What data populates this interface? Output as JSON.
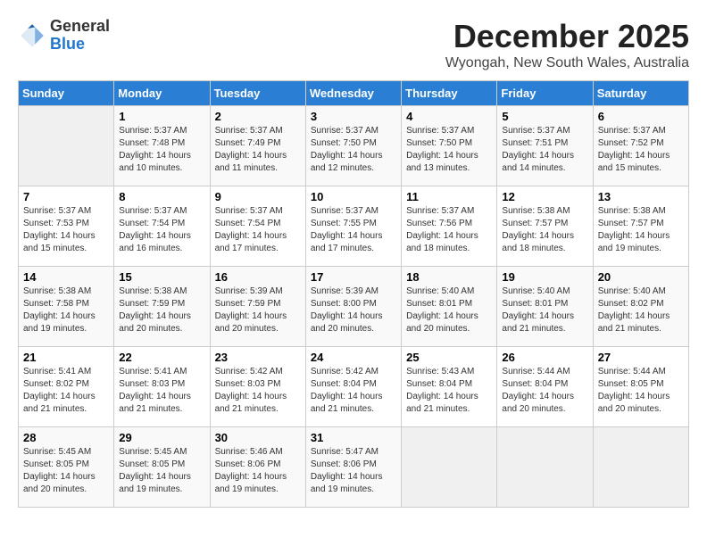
{
  "logo": {
    "general": "General",
    "blue": "Blue"
  },
  "title": "December 2025",
  "subtitle": "Wyongah, New South Wales, Australia",
  "weekdays": [
    "Sunday",
    "Monday",
    "Tuesday",
    "Wednesday",
    "Thursday",
    "Friday",
    "Saturday"
  ],
  "weeks": [
    [
      {
        "day": "",
        "info": ""
      },
      {
        "day": "1",
        "info": "Sunrise: 5:37 AM\nSunset: 7:48 PM\nDaylight: 14 hours\nand 10 minutes."
      },
      {
        "day": "2",
        "info": "Sunrise: 5:37 AM\nSunset: 7:49 PM\nDaylight: 14 hours\nand 11 minutes."
      },
      {
        "day": "3",
        "info": "Sunrise: 5:37 AM\nSunset: 7:50 PM\nDaylight: 14 hours\nand 12 minutes."
      },
      {
        "day": "4",
        "info": "Sunrise: 5:37 AM\nSunset: 7:50 PM\nDaylight: 14 hours\nand 13 minutes."
      },
      {
        "day": "5",
        "info": "Sunrise: 5:37 AM\nSunset: 7:51 PM\nDaylight: 14 hours\nand 14 minutes."
      },
      {
        "day": "6",
        "info": "Sunrise: 5:37 AM\nSunset: 7:52 PM\nDaylight: 14 hours\nand 15 minutes."
      }
    ],
    [
      {
        "day": "7",
        "info": "Sunrise: 5:37 AM\nSunset: 7:53 PM\nDaylight: 14 hours\nand 15 minutes."
      },
      {
        "day": "8",
        "info": "Sunrise: 5:37 AM\nSunset: 7:54 PM\nDaylight: 14 hours\nand 16 minutes."
      },
      {
        "day": "9",
        "info": "Sunrise: 5:37 AM\nSunset: 7:54 PM\nDaylight: 14 hours\nand 17 minutes."
      },
      {
        "day": "10",
        "info": "Sunrise: 5:37 AM\nSunset: 7:55 PM\nDaylight: 14 hours\nand 17 minutes."
      },
      {
        "day": "11",
        "info": "Sunrise: 5:37 AM\nSunset: 7:56 PM\nDaylight: 14 hours\nand 18 minutes."
      },
      {
        "day": "12",
        "info": "Sunrise: 5:38 AM\nSunset: 7:57 PM\nDaylight: 14 hours\nand 18 minutes."
      },
      {
        "day": "13",
        "info": "Sunrise: 5:38 AM\nSunset: 7:57 PM\nDaylight: 14 hours\nand 19 minutes."
      }
    ],
    [
      {
        "day": "14",
        "info": "Sunrise: 5:38 AM\nSunset: 7:58 PM\nDaylight: 14 hours\nand 19 minutes."
      },
      {
        "day": "15",
        "info": "Sunrise: 5:38 AM\nSunset: 7:59 PM\nDaylight: 14 hours\nand 20 minutes."
      },
      {
        "day": "16",
        "info": "Sunrise: 5:39 AM\nSunset: 7:59 PM\nDaylight: 14 hours\nand 20 minutes."
      },
      {
        "day": "17",
        "info": "Sunrise: 5:39 AM\nSunset: 8:00 PM\nDaylight: 14 hours\nand 20 minutes."
      },
      {
        "day": "18",
        "info": "Sunrise: 5:40 AM\nSunset: 8:01 PM\nDaylight: 14 hours\nand 20 minutes."
      },
      {
        "day": "19",
        "info": "Sunrise: 5:40 AM\nSunset: 8:01 PM\nDaylight: 14 hours\nand 21 minutes."
      },
      {
        "day": "20",
        "info": "Sunrise: 5:40 AM\nSunset: 8:02 PM\nDaylight: 14 hours\nand 21 minutes."
      }
    ],
    [
      {
        "day": "21",
        "info": "Sunrise: 5:41 AM\nSunset: 8:02 PM\nDaylight: 14 hours\nand 21 minutes."
      },
      {
        "day": "22",
        "info": "Sunrise: 5:41 AM\nSunset: 8:03 PM\nDaylight: 14 hours\nand 21 minutes."
      },
      {
        "day": "23",
        "info": "Sunrise: 5:42 AM\nSunset: 8:03 PM\nDaylight: 14 hours\nand 21 minutes."
      },
      {
        "day": "24",
        "info": "Sunrise: 5:42 AM\nSunset: 8:04 PM\nDaylight: 14 hours\nand 21 minutes."
      },
      {
        "day": "25",
        "info": "Sunrise: 5:43 AM\nSunset: 8:04 PM\nDaylight: 14 hours\nand 21 minutes."
      },
      {
        "day": "26",
        "info": "Sunrise: 5:44 AM\nSunset: 8:04 PM\nDaylight: 14 hours\nand 20 minutes."
      },
      {
        "day": "27",
        "info": "Sunrise: 5:44 AM\nSunset: 8:05 PM\nDaylight: 14 hours\nand 20 minutes."
      }
    ],
    [
      {
        "day": "28",
        "info": "Sunrise: 5:45 AM\nSunset: 8:05 PM\nDaylight: 14 hours\nand 20 minutes."
      },
      {
        "day": "29",
        "info": "Sunrise: 5:45 AM\nSunset: 8:05 PM\nDaylight: 14 hours\nand 19 minutes."
      },
      {
        "day": "30",
        "info": "Sunrise: 5:46 AM\nSunset: 8:06 PM\nDaylight: 14 hours\nand 19 minutes."
      },
      {
        "day": "31",
        "info": "Sunrise: 5:47 AM\nSunset: 8:06 PM\nDaylight: 14 hours\nand 19 minutes."
      },
      {
        "day": "",
        "info": ""
      },
      {
        "day": "",
        "info": ""
      },
      {
        "day": "",
        "info": ""
      }
    ]
  ]
}
